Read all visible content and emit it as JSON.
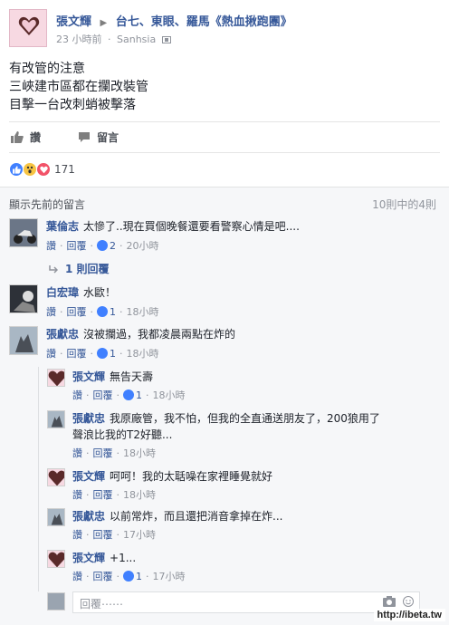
{
  "post": {
    "author": "張文輝",
    "group": "台七、東眼、羅馬《熱血揪跑團》",
    "time": "23 小時前",
    "separator": "·",
    "via": "Sanhsia",
    "body": [
      "有改管的注意",
      "三峽建市區都在攔改裝管",
      "目擊一台改刺蛸被擊落"
    ],
    "like_label": "讚",
    "comment_label": "留言",
    "reaction_count": "171"
  },
  "comments_section": {
    "view_previous": "顯示先前的留言",
    "count_label": "10則中的4則",
    "comments": [
      {
        "name": "葉倫志",
        "text": "太慘了..現在買個晚餐還要看警察心情是吧....",
        "like": "讚",
        "reply": "回覆",
        "likes": "2",
        "time": "20小時"
      },
      {
        "name": "白宏瑋",
        "text": "水歐！",
        "like": "讚",
        "reply": "回覆",
        "likes": "1",
        "time": "18小時"
      },
      {
        "name": "張獻忠",
        "text": "沒被攔過，我都凌晨兩點在炸的",
        "like": "讚",
        "reply": "回覆",
        "likes": "1",
        "time": "18小時"
      }
    ],
    "replies_link": "1 則回覆",
    "replies": [
      {
        "name": "張文輝",
        "text": "無告天壽",
        "like": "讚",
        "reply": "回覆",
        "likes": "1",
        "time": "18小時"
      },
      {
        "name": "張獻忠",
        "text": "我原廠管，我不怕，但我的全直通送朋友了，200狼用了",
        "text2": "聲浪比我的T2好聽...",
        "like": "讚",
        "reply": "回覆",
        "time": "18小時"
      },
      {
        "name": "張文輝",
        "text": "呵呵！我的太聒噪在家裡睡覺就好",
        "like": "讚",
        "reply": "回覆",
        "time": "18小時"
      },
      {
        "name": "張獻忠",
        "text": "以前常炸，而且還把消音拿掉在炸...",
        "like": "讚",
        "reply": "回覆",
        "time": "17小時"
      },
      {
        "name": "張文輝",
        "text": "+1...",
        "like": "讚",
        "reply": "回覆",
        "likes": "1",
        "time": "17小時"
      }
    ],
    "reply_placeholder": "回覆⋯⋯"
  },
  "watermark": "http://ibeta.tw",
  "colors": {
    "link": "#365899",
    "like_blue": "#4080ff",
    "wow_yellow": "#f7c443",
    "love_red": "#f25268",
    "meta_gray": "#90949c"
  }
}
